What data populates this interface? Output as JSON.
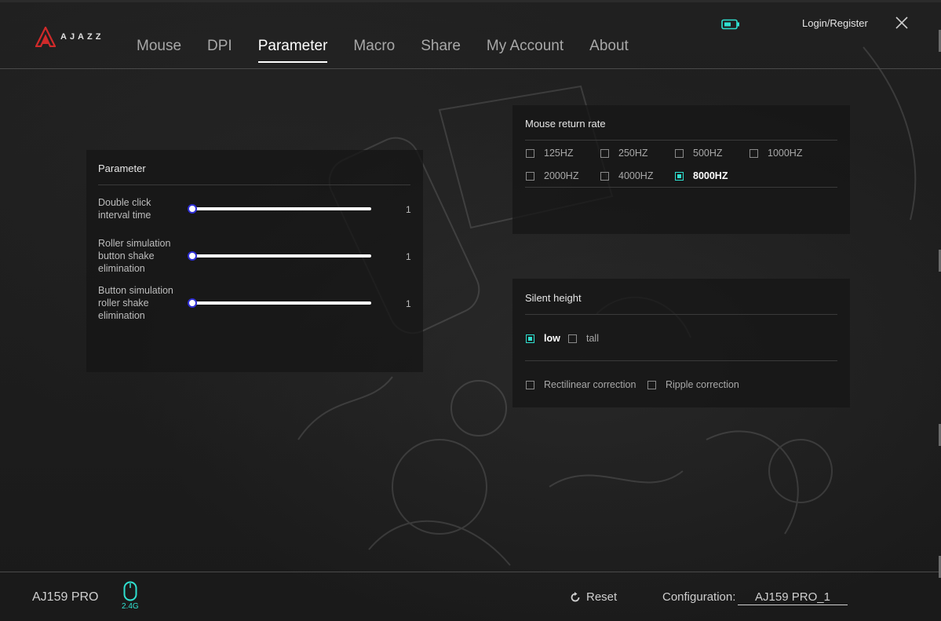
{
  "app": {
    "logo_text": "AJAZZ",
    "login_label": "Login/Register"
  },
  "nav": {
    "items": [
      {
        "label": "Mouse",
        "name": "tab-mouse",
        "active": false
      },
      {
        "label": "DPI",
        "name": "tab-dpi",
        "active": false
      },
      {
        "label": "Parameter",
        "name": "tab-parameter",
        "active": true
      },
      {
        "label": "Macro",
        "name": "tab-macro",
        "active": false
      },
      {
        "label": "Share",
        "name": "tab-share",
        "active": false
      },
      {
        "label": "My Account",
        "name": "tab-my-account",
        "active": false
      },
      {
        "label": "About",
        "name": "tab-about",
        "active": false
      }
    ]
  },
  "parameter_panel": {
    "title": "Parameter",
    "sliders": [
      {
        "label": "Double click interval time",
        "value": "1"
      },
      {
        "label": "Roller simulation button shake elimination",
        "value": "1"
      },
      {
        "label": "Button simulation roller shake elimination",
        "value": "1"
      }
    ]
  },
  "return_rate_panel": {
    "title": "Mouse return rate",
    "options": [
      {
        "label": "125HZ",
        "checked": false
      },
      {
        "label": "250HZ",
        "checked": false
      },
      {
        "label": "500HZ",
        "checked": false
      },
      {
        "label": "1000HZ",
        "checked": false
      },
      {
        "label": "2000HZ",
        "checked": false
      },
      {
        "label": "4000HZ",
        "checked": false
      },
      {
        "label": "8000HZ",
        "checked": true
      }
    ]
  },
  "silent_panel": {
    "title": "Silent height",
    "height_options": [
      {
        "label": "low",
        "checked": true
      },
      {
        "label": "tall",
        "checked": false
      }
    ],
    "correction_options": [
      {
        "label": "Rectilinear correction",
        "checked": false
      },
      {
        "label": "Ripple correction",
        "checked": false
      }
    ]
  },
  "footer": {
    "model": "AJ159 PRO",
    "connection": "2.4G",
    "reset_label": "Reset",
    "config_label": "Configuration:",
    "config_value": "AJ159 PRO_1"
  },
  "colors": {
    "accent": "#2fe0d0",
    "background": "#1c1c1c",
    "logo_red": "#d02a2a"
  }
}
